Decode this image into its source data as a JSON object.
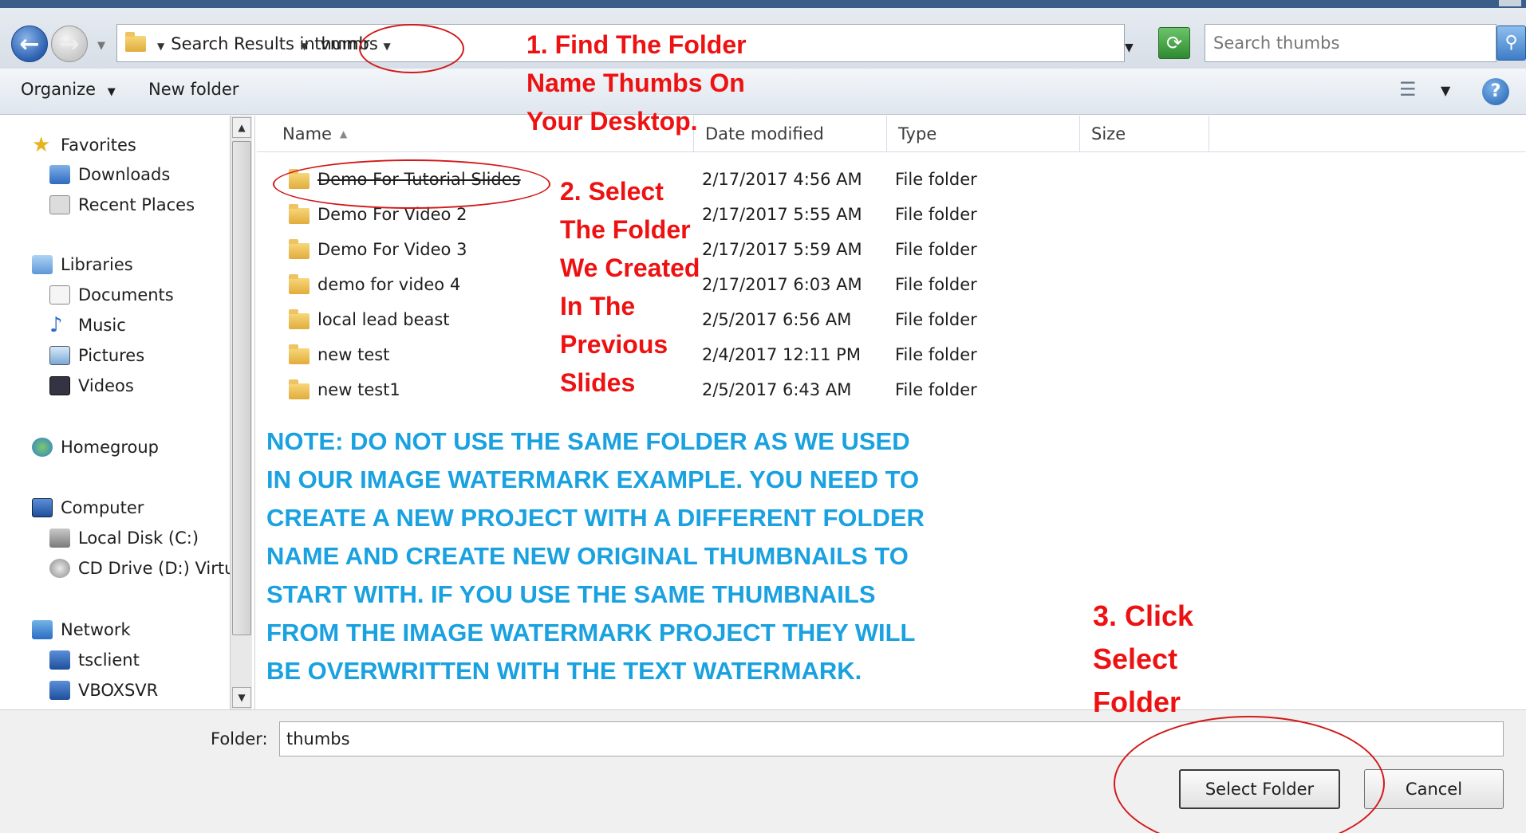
{
  "address": {
    "crumbs": [
      "Search Results in vmmr",
      "thumbs"
    ],
    "search_placeholder": "Search thumbs"
  },
  "toolbar": {
    "organize": "Organize",
    "new_folder": "New folder"
  },
  "nav": {
    "favorites": "Favorites",
    "downloads": "Downloads",
    "recent": "Recent Places",
    "libraries": "Libraries",
    "documents": "Documents",
    "music": "Music",
    "pictures": "Pictures",
    "videos": "Videos",
    "homegroup": "Homegroup",
    "computer": "Computer",
    "local_disk": "Local Disk (C:)",
    "cd_drive": "CD Drive (D:) Virtu",
    "network": "Network",
    "tsclient": "tsclient",
    "vboxsvr": "VBOXSVR"
  },
  "columns": {
    "name": "Name",
    "date": "Date modified",
    "type": "Type",
    "size": "Size"
  },
  "files": [
    {
      "name": "Demo For Tutorial Slides",
      "date": "2/17/2017 4:56 AM",
      "type": "File folder"
    },
    {
      "name": "Demo For Video 2",
      "date": "2/17/2017 5:55 AM",
      "type": "File folder"
    },
    {
      "name": "Demo For Video 3",
      "date": "2/17/2017 5:59 AM",
      "type": "File folder"
    },
    {
      "name": "demo for video 4",
      "date": "2/17/2017 6:03 AM",
      "type": "File folder"
    },
    {
      "name": "local lead beast",
      "date": "2/5/2017 6:56 AM",
      "type": "File folder"
    },
    {
      "name": "new test",
      "date": "2/4/2017 12:11 PM",
      "type": "File folder"
    },
    {
      "name": "new test1",
      "date": "2/5/2017 6:43 AM",
      "type": "File folder"
    }
  ],
  "folderbar": {
    "label": "Folder:",
    "value": "thumbs",
    "select": "Select Folder",
    "cancel": "Cancel"
  },
  "annotations": {
    "step1": [
      "1. Find The Folder",
      "Name Thumbs On",
      "Your Desktop."
    ],
    "step2": [
      "2. Select",
      "The Folder",
      "We Created",
      "In The",
      "Previous",
      "Slides"
    ],
    "step3": [
      "3. Click",
      "Select",
      "Folder"
    ],
    "note": [
      "NOTE: DO NOT USE THE SAME FOLDER AS WE USED",
      "IN OUR IMAGE WATERMARK EXAMPLE. YOU NEED TO",
      "CREATE A NEW PROJECT WITH A DIFFERENT FOLDER",
      "NAME AND CREATE NEW ORIGINAL THUMBNAILS TO",
      "START WITH. IF YOU USE THE SAME THUMBNAILS",
      "FROM THE IMAGE WATERMARK PROJECT THEY WILL",
      "BE OVERWRITTEN WITH THE TEXT WATERMARK."
    ]
  },
  "colors": {
    "annotation_red": "#ee1111",
    "annotation_blue": "#19a1e0"
  }
}
